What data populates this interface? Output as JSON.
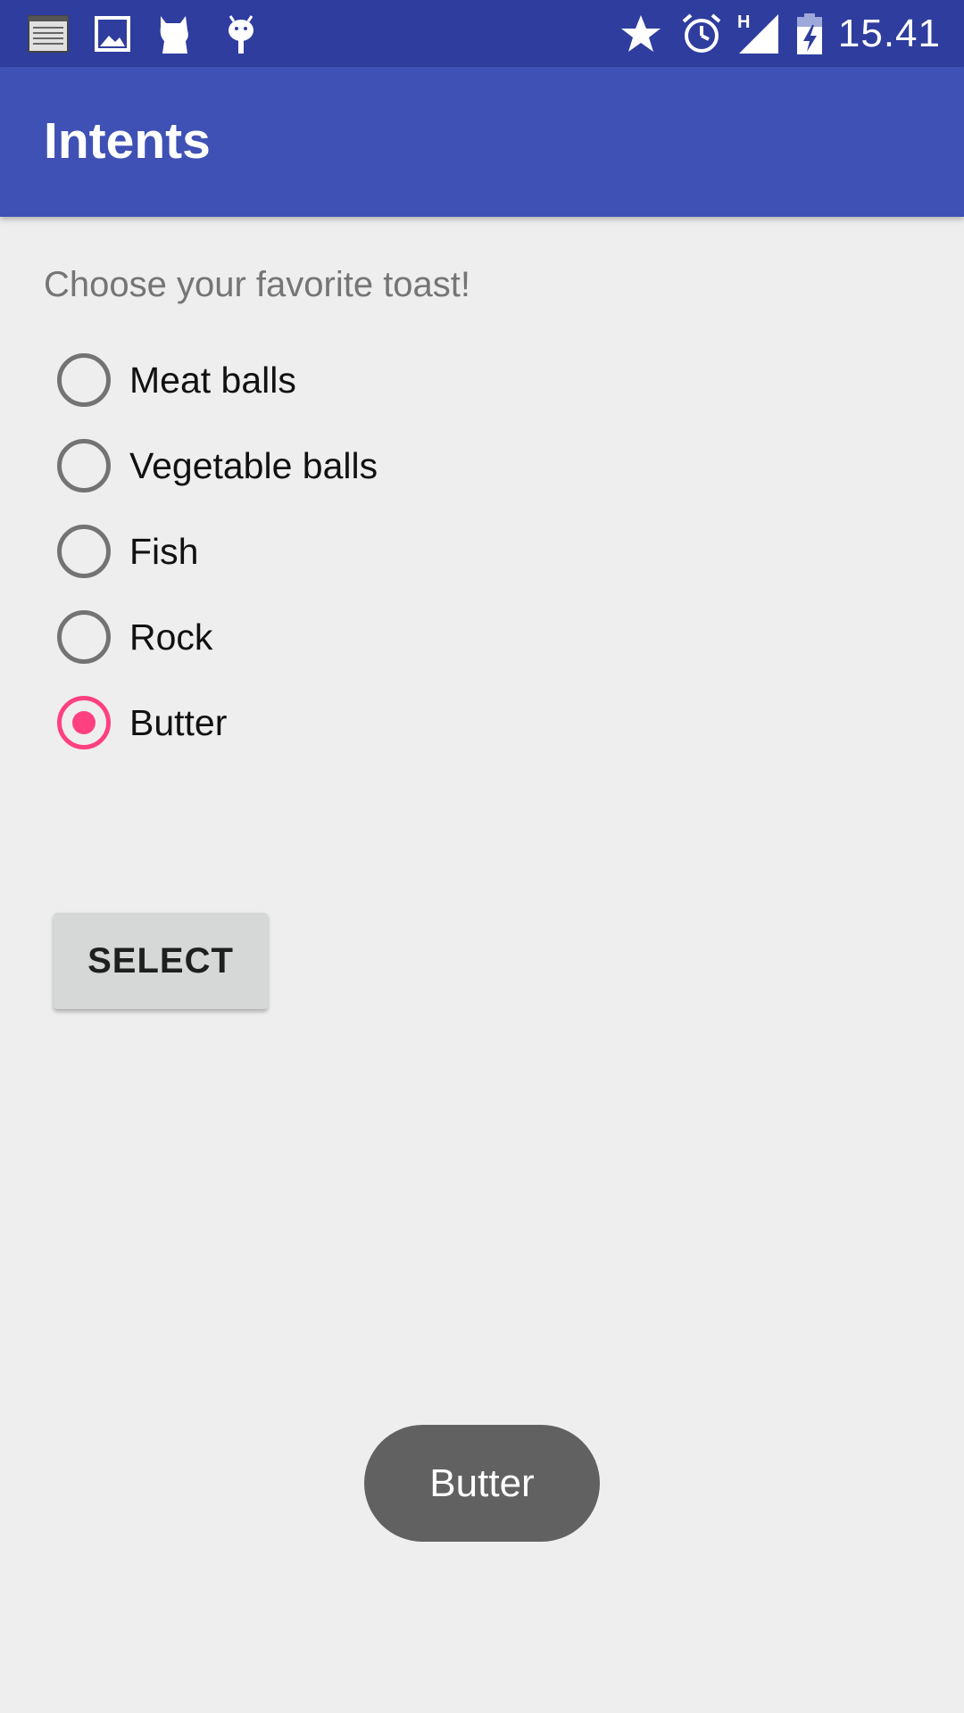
{
  "status_bar": {
    "time": "15.41",
    "left_icons": [
      "notes-icon",
      "image-icon",
      "cat-icon",
      "android-icon"
    ],
    "right_icons": [
      "star-icon",
      "alarm-icon",
      "network-h-icon",
      "signal-icon",
      "battery-charging-icon"
    ],
    "network_label": "H"
  },
  "app_bar": {
    "title": "Intents"
  },
  "main": {
    "prompt": "Choose your favorite toast!",
    "options": [
      {
        "label": "Meat balls",
        "checked": false
      },
      {
        "label": "Vegetable balls",
        "checked": false
      },
      {
        "label": "Fish",
        "checked": false
      },
      {
        "label": "Rock",
        "checked": false
      },
      {
        "label": "Butter",
        "checked": true
      }
    ],
    "select_label": "SELECT"
  },
  "toast": {
    "text": "Butter"
  },
  "colors": {
    "status_bar": "#2f3d9e",
    "app_bar": "#3f51b5",
    "accent": "#ff4081",
    "background": "#eeeeee",
    "toast_bg": "#616161"
  }
}
